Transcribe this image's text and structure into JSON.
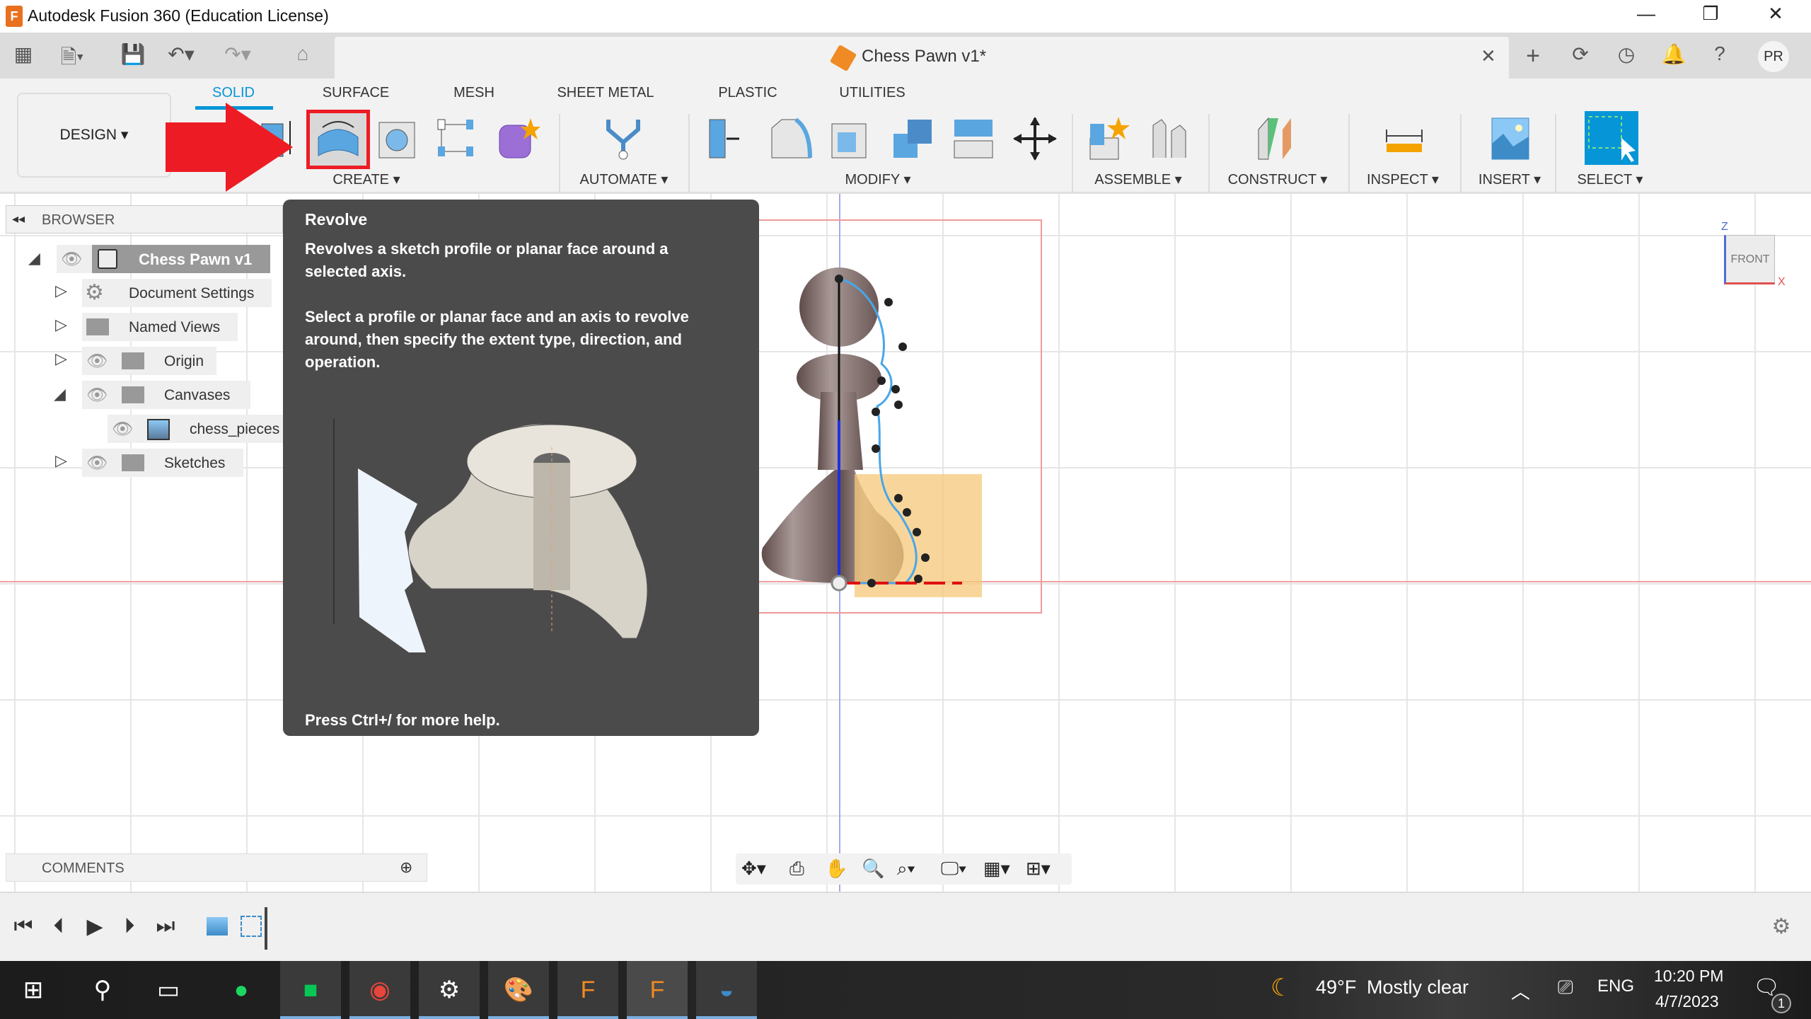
{
  "app": {
    "title": "Autodesk Fusion 360 (Education License)",
    "document_tab": "Chess Pawn v1*",
    "user_initials": "PR"
  },
  "ribbon": {
    "workspace": "DESIGN",
    "tabs": [
      "SOLID",
      "SURFACE",
      "MESH",
      "SHEET METAL",
      "PLASTIC",
      "UTILITIES"
    ],
    "active_tab": "SOLID",
    "groups": [
      "CREATE",
      "AUTOMATE",
      "MODIFY",
      "ASSEMBLE",
      "CONSTRUCT",
      "INSPECT",
      "INSERT",
      "SELECT"
    ],
    "highlighted_tool": "Revolve"
  },
  "browser": {
    "title": "BROWSER",
    "items": [
      {
        "label": "Chess Pawn v1"
      },
      {
        "label": "Document Settings"
      },
      {
        "label": "Named Views"
      },
      {
        "label": "Origin"
      },
      {
        "label": "Canvases"
      },
      {
        "label": "chess_pieces"
      },
      {
        "label": "Sketches"
      }
    ]
  },
  "tooltip": {
    "title": "Revolve",
    "description": "Revolves a sketch profile or planar face around a selected axis.",
    "instructions": "Select a profile or planar face and an axis to revolve around, then specify the extent type, direction, and operation.",
    "help": "Press Ctrl+/ for more help."
  },
  "viewcube": {
    "face": "FRONT",
    "z": "Z",
    "x": "X"
  },
  "comments": {
    "label": "COMMENTS"
  },
  "taskbar": {
    "weather_temp": "49°F",
    "weather_text": "Mostly clear",
    "language": "ENG",
    "time": "10:20 PM",
    "date": "4/7/2023",
    "notifications": "1"
  },
  "colors": {
    "accent": "#0696d7",
    "arrow": "#ed1c24",
    "tooltip_bg": "#4b4b4b"
  }
}
